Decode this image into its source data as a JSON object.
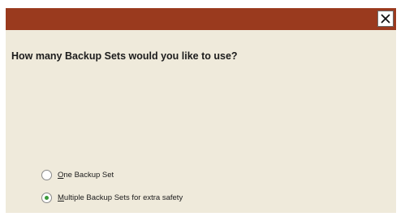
{
  "titlebar": {
    "close_icon": "close-icon",
    "color": "#9a3a1e"
  },
  "question": "How many Backup Sets would you like to use?",
  "options": [
    {
      "mnemonic": "O",
      "rest": "ne Backup Set",
      "selected": false
    },
    {
      "mnemonic": "M",
      "rest": "ultiple Backup Sets for extra safety",
      "selected": true
    }
  ],
  "colors": {
    "dialog_bg": "#efeadb",
    "radio_selected": "#3a9a3a"
  }
}
